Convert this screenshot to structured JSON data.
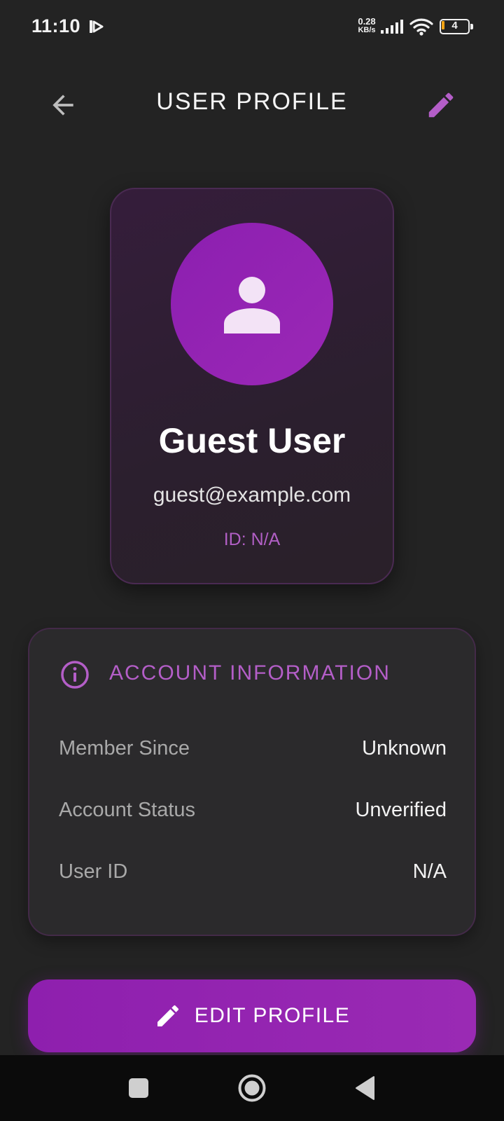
{
  "status_bar": {
    "time": "11:10",
    "net_speed_value": "0.28",
    "net_speed_unit": "KB/s",
    "battery_level": "4",
    "battery_color": "#f2a414",
    "icons": [
      "app-notification-icon",
      "signal-icon",
      "wifi-icon",
      "battery-icon"
    ]
  },
  "header": {
    "title": "USER PROFILE",
    "back_icon": "arrow-back-icon",
    "edit_icon": "pencil-icon"
  },
  "profile": {
    "avatar_icon": "person-icon",
    "name": "Guest User",
    "email": "guest@example.com",
    "id_text": "ID: N/A"
  },
  "account_info": {
    "icon": "info-icon",
    "title": "ACCOUNT INFORMATION",
    "rows": [
      {
        "label": "Member Since",
        "value": "Unknown"
      },
      {
        "label": "Account Status",
        "value": "Unverified"
      },
      {
        "label": "User ID",
        "value": "N/A"
      }
    ]
  },
  "actions": {
    "edit_profile_label": "EDIT PROFILE",
    "edit_profile_icon": "pencil-icon"
  },
  "nav_bar": {
    "icons": [
      "recents-square-icon",
      "home-circle-icon",
      "back-triangle-icon"
    ]
  },
  "colors": {
    "accent": "#9b27b0",
    "accent_text": "#b45ec8",
    "background": "#232323",
    "card": "#2b2a2c"
  }
}
